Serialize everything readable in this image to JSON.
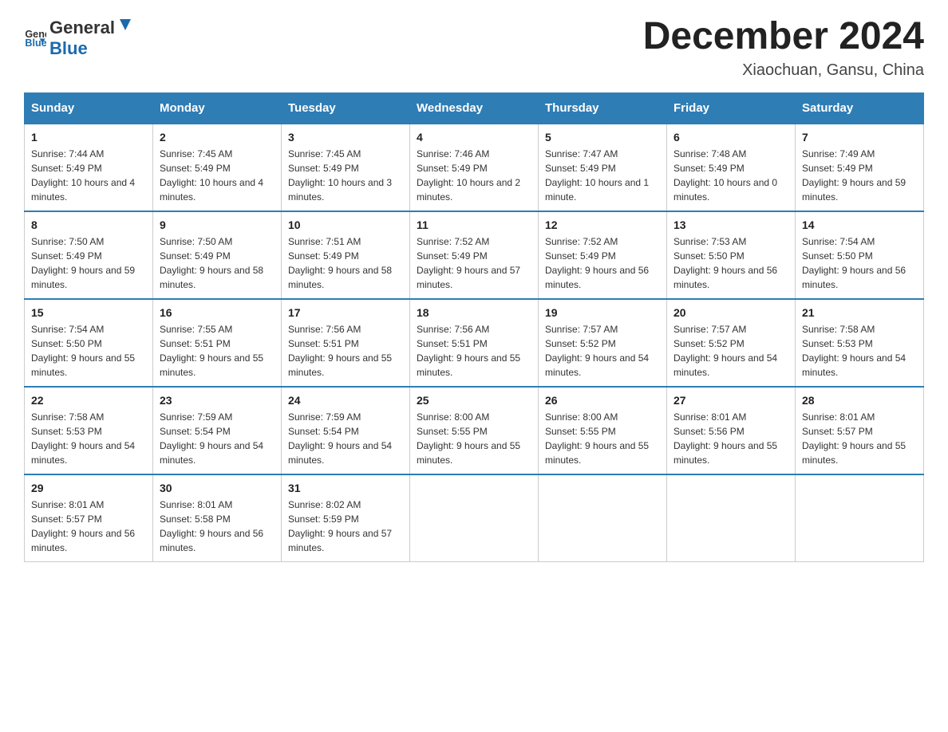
{
  "header": {
    "logo_general": "General",
    "logo_blue": "Blue",
    "month_title": "December 2024",
    "location": "Xiaochuan, Gansu, China"
  },
  "days_of_week": [
    "Sunday",
    "Monday",
    "Tuesday",
    "Wednesday",
    "Thursday",
    "Friday",
    "Saturday"
  ],
  "weeks": [
    [
      {
        "day": "1",
        "sunrise": "7:44 AM",
        "sunset": "5:49 PM",
        "daylight": "10 hours and 4 minutes."
      },
      {
        "day": "2",
        "sunrise": "7:45 AM",
        "sunset": "5:49 PM",
        "daylight": "10 hours and 4 minutes."
      },
      {
        "day": "3",
        "sunrise": "7:45 AM",
        "sunset": "5:49 PM",
        "daylight": "10 hours and 3 minutes."
      },
      {
        "day": "4",
        "sunrise": "7:46 AM",
        "sunset": "5:49 PM",
        "daylight": "10 hours and 2 minutes."
      },
      {
        "day": "5",
        "sunrise": "7:47 AM",
        "sunset": "5:49 PM",
        "daylight": "10 hours and 1 minute."
      },
      {
        "day": "6",
        "sunrise": "7:48 AM",
        "sunset": "5:49 PM",
        "daylight": "10 hours and 0 minutes."
      },
      {
        "day": "7",
        "sunrise": "7:49 AM",
        "sunset": "5:49 PM",
        "daylight": "9 hours and 59 minutes."
      }
    ],
    [
      {
        "day": "8",
        "sunrise": "7:50 AM",
        "sunset": "5:49 PM",
        "daylight": "9 hours and 59 minutes."
      },
      {
        "day": "9",
        "sunrise": "7:50 AM",
        "sunset": "5:49 PM",
        "daylight": "9 hours and 58 minutes."
      },
      {
        "day": "10",
        "sunrise": "7:51 AM",
        "sunset": "5:49 PM",
        "daylight": "9 hours and 58 minutes."
      },
      {
        "day": "11",
        "sunrise": "7:52 AM",
        "sunset": "5:49 PM",
        "daylight": "9 hours and 57 minutes."
      },
      {
        "day": "12",
        "sunrise": "7:52 AM",
        "sunset": "5:49 PM",
        "daylight": "9 hours and 56 minutes."
      },
      {
        "day": "13",
        "sunrise": "7:53 AM",
        "sunset": "5:50 PM",
        "daylight": "9 hours and 56 minutes."
      },
      {
        "day": "14",
        "sunrise": "7:54 AM",
        "sunset": "5:50 PM",
        "daylight": "9 hours and 56 minutes."
      }
    ],
    [
      {
        "day": "15",
        "sunrise": "7:54 AM",
        "sunset": "5:50 PM",
        "daylight": "9 hours and 55 minutes."
      },
      {
        "day": "16",
        "sunrise": "7:55 AM",
        "sunset": "5:51 PM",
        "daylight": "9 hours and 55 minutes."
      },
      {
        "day": "17",
        "sunrise": "7:56 AM",
        "sunset": "5:51 PM",
        "daylight": "9 hours and 55 minutes."
      },
      {
        "day": "18",
        "sunrise": "7:56 AM",
        "sunset": "5:51 PM",
        "daylight": "9 hours and 55 minutes."
      },
      {
        "day": "19",
        "sunrise": "7:57 AM",
        "sunset": "5:52 PM",
        "daylight": "9 hours and 54 minutes."
      },
      {
        "day": "20",
        "sunrise": "7:57 AM",
        "sunset": "5:52 PM",
        "daylight": "9 hours and 54 minutes."
      },
      {
        "day": "21",
        "sunrise": "7:58 AM",
        "sunset": "5:53 PM",
        "daylight": "9 hours and 54 minutes."
      }
    ],
    [
      {
        "day": "22",
        "sunrise": "7:58 AM",
        "sunset": "5:53 PM",
        "daylight": "9 hours and 54 minutes."
      },
      {
        "day": "23",
        "sunrise": "7:59 AM",
        "sunset": "5:54 PM",
        "daylight": "9 hours and 54 minutes."
      },
      {
        "day": "24",
        "sunrise": "7:59 AM",
        "sunset": "5:54 PM",
        "daylight": "9 hours and 54 minutes."
      },
      {
        "day": "25",
        "sunrise": "8:00 AM",
        "sunset": "5:55 PM",
        "daylight": "9 hours and 55 minutes."
      },
      {
        "day": "26",
        "sunrise": "8:00 AM",
        "sunset": "5:55 PM",
        "daylight": "9 hours and 55 minutes."
      },
      {
        "day": "27",
        "sunrise": "8:01 AM",
        "sunset": "5:56 PM",
        "daylight": "9 hours and 55 minutes."
      },
      {
        "day": "28",
        "sunrise": "8:01 AM",
        "sunset": "5:57 PM",
        "daylight": "9 hours and 55 minutes."
      }
    ],
    [
      {
        "day": "29",
        "sunrise": "8:01 AM",
        "sunset": "5:57 PM",
        "daylight": "9 hours and 56 minutes."
      },
      {
        "day": "30",
        "sunrise": "8:01 AM",
        "sunset": "5:58 PM",
        "daylight": "9 hours and 56 minutes."
      },
      {
        "day": "31",
        "sunrise": "8:02 AM",
        "sunset": "5:59 PM",
        "daylight": "9 hours and 57 minutes."
      },
      null,
      null,
      null,
      null
    ]
  ]
}
